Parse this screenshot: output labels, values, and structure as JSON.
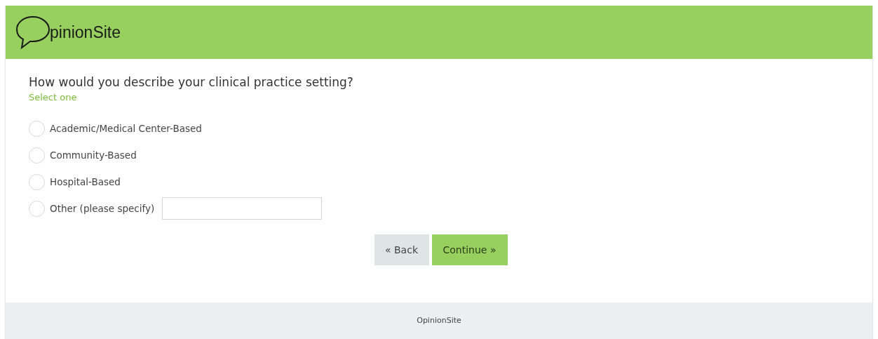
{
  "header": {
    "logo_text": "pinionSite"
  },
  "question": {
    "title": "How would you describe your clinical practice setting?",
    "hint": "Select one"
  },
  "options": [
    {
      "label": "Academic/Medical Center-Based",
      "selected": false,
      "kind": "plain"
    },
    {
      "label": "Community-Based",
      "selected": false,
      "kind": "plain"
    },
    {
      "label": "Hospital-Based",
      "selected": false,
      "kind": "plain"
    },
    {
      "label": "Other (please specify)",
      "selected": false,
      "kind": "specify"
    }
  ],
  "buttons": [
    {
      "label": "« Back",
      "kind": "secondary"
    },
    {
      "label": "Continue »",
      "kind": "primary"
    }
  ],
  "footer": {
    "text": "OpinionSite"
  }
}
